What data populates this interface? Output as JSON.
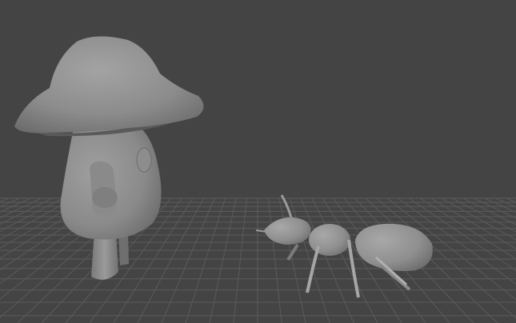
{
  "viewport": {
    "background_color": "#444444",
    "grid_color": "#5b5b5b",
    "grid_visible": true,
    "objects": [
      {
        "name": "mushroom-character",
        "shading": "smooth-grey"
      },
      {
        "name": "ant-character",
        "shading": "smooth-grey"
      }
    ]
  }
}
